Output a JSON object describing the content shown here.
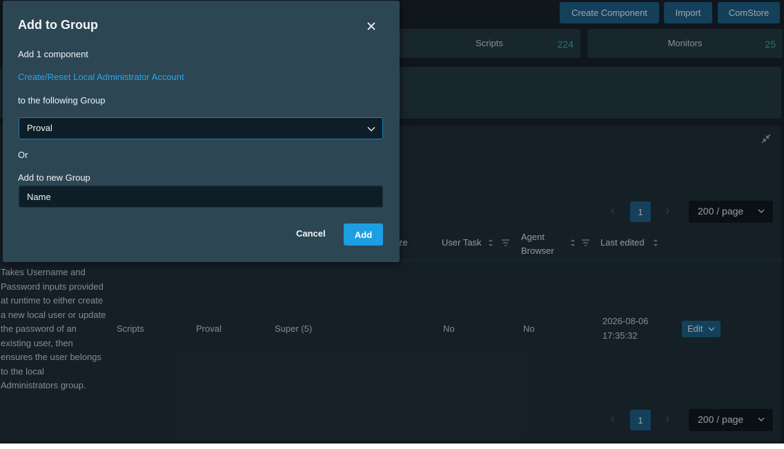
{
  "toolbar": {
    "create_component": "Create Component",
    "import": "Import",
    "comstore": "ComStore"
  },
  "stats": {
    "scripts": {
      "label": "Scripts",
      "count": "224"
    },
    "monitors": {
      "label": "Monitors",
      "count": "25"
    }
  },
  "pagination": {
    "page": "1",
    "per_page": "200 / page"
  },
  "columns": {
    "size_partial": "ze",
    "user_task": "User Task",
    "agent_browser_line1": "Agent",
    "agent_browser_line2": "Browser",
    "last_edited": "Last edited"
  },
  "row": {
    "description_lines": [
      "Takes Username and",
      "Password inputs provided",
      "at runtime to either create",
      "a new local user or update",
      "the password of an",
      "existing user, then",
      "ensures the user belongs",
      "to the local",
      "Administrators group."
    ],
    "category": "Scripts",
    "group": "Proval",
    "level": "Super (5)",
    "user_task": "No",
    "agent_browser": "No",
    "last_edited_date": "2026-08-06",
    "last_edited_time": "17:35:32",
    "edit_label": "Edit"
  },
  "modal": {
    "title": "Add to Group",
    "add_count_text": "Add 1 component",
    "component_name": "Create/Reset Local Administrator Account",
    "following_group_text": "to the following Group",
    "selected_group": "Proval",
    "or_text": "Or",
    "new_group_label": "Add to new Group",
    "new_group_placeholder": "Name",
    "cancel_label": "Cancel",
    "add_label": "Add"
  },
  "colors": {
    "background": "#17232b",
    "primary_button": "#1f5f86",
    "accent_link": "#2aa6e6",
    "add_button": "#1d9ee0",
    "count_teal": "#2fb3a0",
    "modal_bg": "#2c4654"
  },
  "icons": [
    "close-icon",
    "chevron-down-icon",
    "collapse-icon",
    "sort-icon",
    "filter-icon",
    "chevron-left-icon",
    "chevron-right-icon"
  ]
}
